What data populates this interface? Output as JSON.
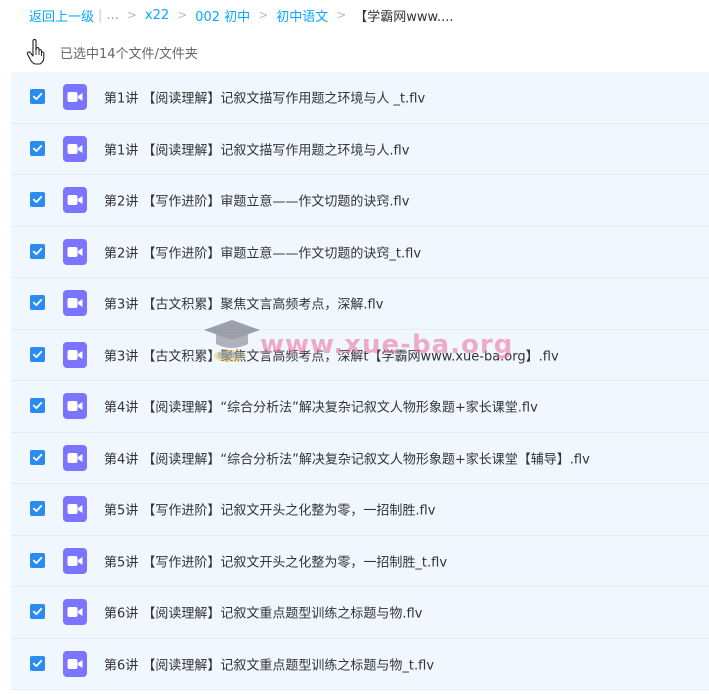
{
  "breadcrumb": {
    "back_label": "返回上一级",
    "ellipsis": "...",
    "separator": ">",
    "crumbs": [
      "x22",
      "002 初中",
      "初中语文"
    ],
    "current": "【学霸网www...."
  },
  "selection": {
    "text": "已选中14个文件/文件夹"
  },
  "files": [
    {
      "name": "第1讲 【阅读理解】记叙文描写作用题之环境与人 _t.flv",
      "checked": true
    },
    {
      "name": "第1讲 【阅读理解】记叙文描写作用题之环境与人.flv",
      "checked": true
    },
    {
      "name": "第2讲 【写作进阶】审题立意——作文切题的诀窍.flv",
      "checked": true
    },
    {
      "name": "第2讲 【写作进阶】审题立意——作文切题的诀窍_t.flv",
      "checked": true
    },
    {
      "name": "第3讲 【古文积累】聚焦文言高频考点，深解.flv",
      "checked": true
    },
    {
      "name": "第3讲 【古文积累】聚焦文言高频考点，深解t【学霸网www.xue-ba.org】.flv",
      "checked": true
    },
    {
      "name": "第4讲 【阅读理解】“综合分析法”解决复杂记叙文人物形象题+家长课堂.flv",
      "checked": true
    },
    {
      "name": "第4讲 【阅读理解】“综合分析法”解决复杂记叙文人物形象题+家长课堂【辅导】.flv",
      "checked": true
    },
    {
      "name": "第5讲 【写作进阶】记叙文开头之化整为零，一招制胜.flv",
      "checked": true
    },
    {
      "name": "第5讲 【写作进阶】记叙文开头之化整为零，一招制胜_t.flv",
      "checked": true
    },
    {
      "name": "第6讲 【阅读理解】记叙文重点题型训练之标题与物.flv",
      "checked": true
    },
    {
      "name": "第6讲 【阅读理解】记叙文重点题型训练之标题与物_t.flv",
      "checked": true
    }
  ],
  "watermark": {
    "text": "www.xue-ba.org"
  },
  "colors": {
    "accent": "#06a7ff",
    "row_selected_bg": "#f0f7ff",
    "checkbox": "#2a8bf2",
    "video_icon": "#7a74ff"
  },
  "icons": {
    "file_icon": "video-file-icon",
    "cursor": "hand-pointer-icon"
  }
}
